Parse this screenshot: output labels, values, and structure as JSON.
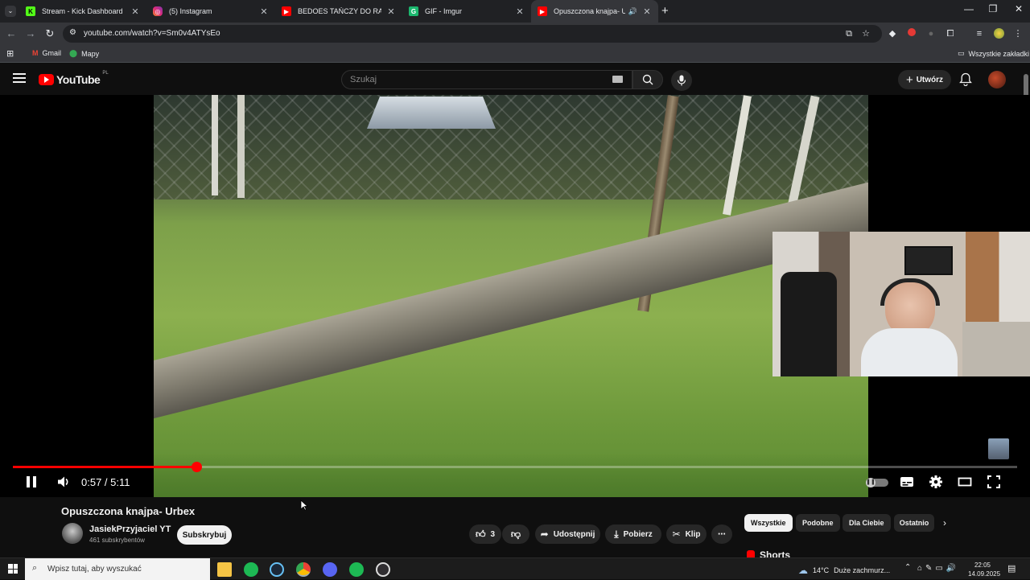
{
  "tabs": [
    {
      "title": "Stream - Kick Dashboard",
      "favicon": "kick-icon",
      "color": "#53fc18"
    },
    {
      "title": "(5) Instagram",
      "favicon": "instagram-icon",
      "color": "#e1306c"
    },
    {
      "title": "BEDOES TAŃCZY DO RAE SREM",
      "favicon": "youtube-icon",
      "color": "#ff0000"
    },
    {
      "title": "GIF - Imgur",
      "favicon": "imgur-icon",
      "color": "#1bb76e"
    },
    {
      "title": "Opuszczona knajpa- Urbex",
      "favicon": "youtube-icon",
      "color": "#ff0000",
      "active": true
    }
  ],
  "address": {
    "url": "youtube.com/watch?v=Sm0v4ATYsEo"
  },
  "bookmarks": {
    "gmail": "Gmail",
    "maps": "Mapy",
    "all": "Wszystkie zakładki"
  },
  "youtube": {
    "logo_text": "YouTube",
    "region": "PL",
    "search_placeholder": "Szukaj",
    "create_label": "Utwórz"
  },
  "player": {
    "current_time": "0:57",
    "duration": "5:11",
    "time_display": "0:57 / 5:11",
    "progress_fraction": 0.183
  },
  "video": {
    "title": "Opuszczona knajpa- Urbex",
    "channel": "JasiekPrzyjaciel YT",
    "subscribers": "461 subskrybentów",
    "subscribe_label": "Subskrybuj",
    "likes": "3",
    "share_label": "Udostępnij",
    "download_label": "Pobierz",
    "clip_label": "Klip"
  },
  "chips": [
    "Wszystkie",
    "Podobne",
    "Dla Ciebie",
    "Ostatnio"
  ],
  "shorts_label": "Shorts",
  "taskbar": {
    "search_placeholder": "Wpisz tutaj, aby wyszukać",
    "temperature": "14°C",
    "weather": "Duże zachmurz...",
    "time": "22:05",
    "date": "14.09.2025"
  },
  "colors": {
    "accent": "#ff0000",
    "bg": "#0f0f0f"
  }
}
